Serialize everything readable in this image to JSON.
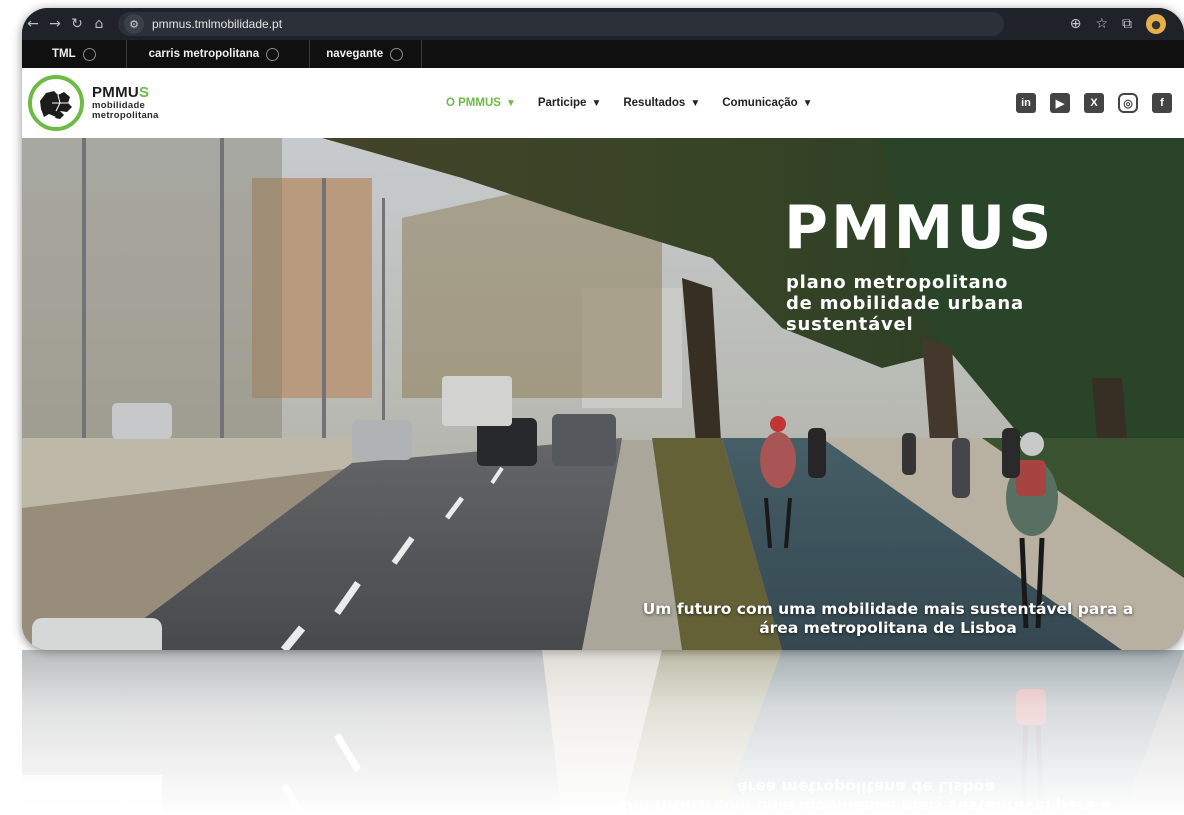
{
  "browser": {
    "url": "pmmus.tmlmobilidade.pt",
    "icons": [
      "back-arrow-icon",
      "forward-arrow-icon",
      "reload-icon",
      "home-icon",
      "site-settings-icon",
      "zoom-icon",
      "bookmark-star-icon",
      "extensions-icon",
      "profile-avatar-icon"
    ]
  },
  "topbar": {
    "items": [
      {
        "label": "TML"
      },
      {
        "label": "carris metropolitana"
      },
      {
        "label": "navegante"
      }
    ]
  },
  "header": {
    "logo": {
      "title_main": "PMMU",
      "title_accent": "S",
      "line1": "mobilidade",
      "line2": "metropolitana"
    },
    "nav": [
      {
        "label": "O PMMUS",
        "active": true
      },
      {
        "label": "Participe",
        "active": false
      },
      {
        "label": "Resultados",
        "active": false
      },
      {
        "label": "Comunicação",
        "active": false
      }
    ],
    "social": [
      {
        "icon": "linkedin-icon",
        "glyph": "in"
      },
      {
        "icon": "youtube-icon",
        "glyph": "▶"
      },
      {
        "icon": "x-icon",
        "glyph": "X"
      },
      {
        "icon": "instagram-icon",
        "glyph": "◎"
      },
      {
        "icon": "facebook-icon",
        "glyph": "f"
      }
    ]
  },
  "hero": {
    "title": "PMMUS",
    "subtitle_lines": [
      "plano metropolitano",
      "de mobilidade urbana",
      "sustentável"
    ],
    "tagline_lines": [
      "Um futuro com uma mobilidade mais sustentável para a",
      "área metropolitana de Lisboa"
    ]
  },
  "colors": {
    "accent": "#6dbb45",
    "topbar_bg": "#101010",
    "browser_bg": "#1f2229"
  }
}
